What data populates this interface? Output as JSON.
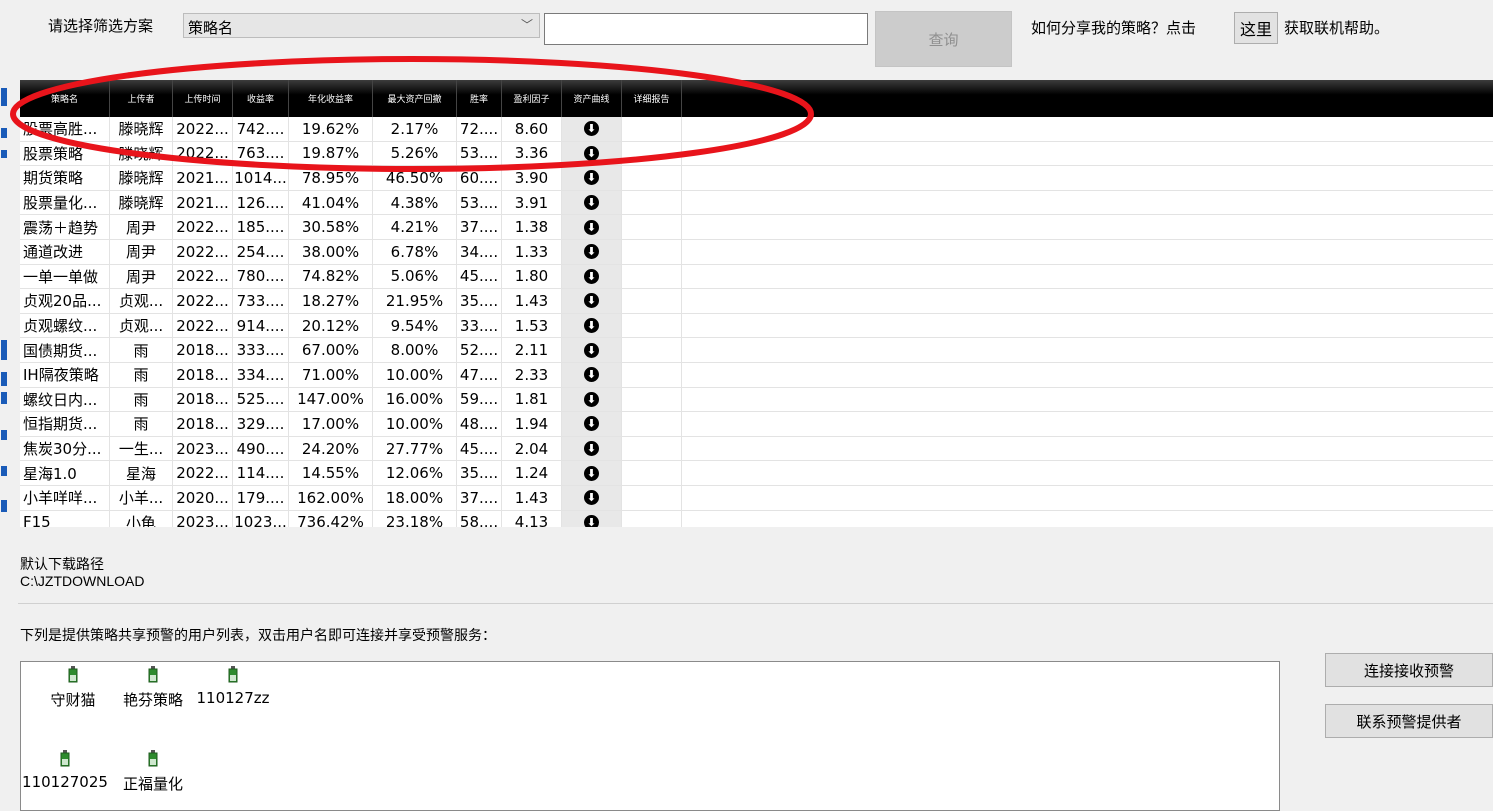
{
  "filter": {
    "label": "请选择筛选方案",
    "selected": "策略名",
    "input_value": "",
    "query_label": "查询"
  },
  "help": {
    "prefix": "如何分享我的策略？点击",
    "link_label": "这里",
    "suffix": "获取联机帮助。"
  },
  "table": {
    "headers": [
      "策略名",
      "上传者",
      "上传时间",
      "收益率",
      "年化收益率",
      "最大资产回撤",
      "胜率",
      "盈利因子",
      "资产曲线",
      "详细报告"
    ],
    "rows": [
      [
        "股票高胜...",
        "滕晓辉",
        "2022...",
        "742....",
        "19.62%",
        "2.17%",
        "72....",
        "8.60"
      ],
      [
        "股票策略",
        "滕晓辉",
        "2022...",
        "763....",
        "19.87%",
        "5.26%",
        "53....",
        "3.36"
      ],
      [
        "期货策略",
        "滕晓辉",
        "2021...",
        "1014...",
        "78.95%",
        "46.50%",
        "60....",
        "3.90"
      ],
      [
        "股票量化...",
        "滕晓辉",
        "2021...",
        "126....",
        "41.04%",
        "4.38%",
        "53....",
        "3.91"
      ],
      [
        "震荡＋趋势",
        "周尹",
        "2022...",
        "185....",
        "30.58%",
        "4.21%",
        "37....",
        "1.38"
      ],
      [
        "通道改进",
        "周尹",
        "2022...",
        "254....",
        "38.00%",
        "6.78%",
        "34....",
        "1.33"
      ],
      [
        "一单一单做",
        "周尹",
        "2022...",
        "780....",
        "74.82%",
        "5.06%",
        "45....",
        "1.80"
      ],
      [
        "贞观20品...",
        "贞观...",
        "2022...",
        "733....",
        "18.27%",
        "21.95%",
        "35....",
        "1.43"
      ],
      [
        "贞观螺纹...",
        "贞观...",
        "2022...",
        "914....",
        "20.12%",
        "9.54%",
        "33....",
        "1.53"
      ],
      [
        "国债期货...",
        "雨",
        "2018...",
        "333....",
        "67.00%",
        "8.00%",
        "52....",
        "2.11"
      ],
      [
        "IH隔夜策略",
        "雨",
        "2018...",
        "334....",
        "71.00%",
        "10.00%",
        "47....",
        "2.33"
      ],
      [
        "螺纹日内...",
        "雨",
        "2018...",
        "525....",
        "147.00%",
        "16.00%",
        "59....",
        "1.81"
      ],
      [
        "恒指期货...",
        "雨",
        "2018...",
        "329....",
        "17.00%",
        "10.00%",
        "48....",
        "1.94"
      ],
      [
        "焦炭30分...",
        "一生...",
        "2023...",
        "490....",
        "24.20%",
        "27.77%",
        "45....",
        "2.04"
      ],
      [
        "星海1.0",
        "星海",
        "2022...",
        "114....",
        "14.55%",
        "12.06%",
        "35....",
        "1.24"
      ],
      [
        "小羊咩咩...",
        "小羊...",
        "2020...",
        "179....",
        "162.00%",
        "18.00%",
        "37....",
        "1.43"
      ],
      [
        "F15",
        "小龟",
        "2023...",
        "1023...",
        "736.42%",
        "23.18%",
        "58....",
        "4.13"
      ]
    ],
    "curve_icon": "download-circle-icon",
    "curve_glyph": "⬇"
  },
  "download": {
    "label": "默认下载路径",
    "path": "C:\\JZTDOWNLOAD"
  },
  "alerts": {
    "caption": "下列是提供策略共享预警的用户列表，双击用户名即可连接并享受预警服务：",
    "users": [
      "守财猫",
      "艳芬策略",
      "110127zz",
      "110127025",
      "正福量化"
    ],
    "connect_label": "连接接收预警",
    "contact_label": "联系预警提供者"
  },
  "colors": {
    "accent": "#1a5bb8",
    "annotation": "#e8141b",
    "header_bg": "#000000",
    "user_icon": "#2e8b2e"
  }
}
